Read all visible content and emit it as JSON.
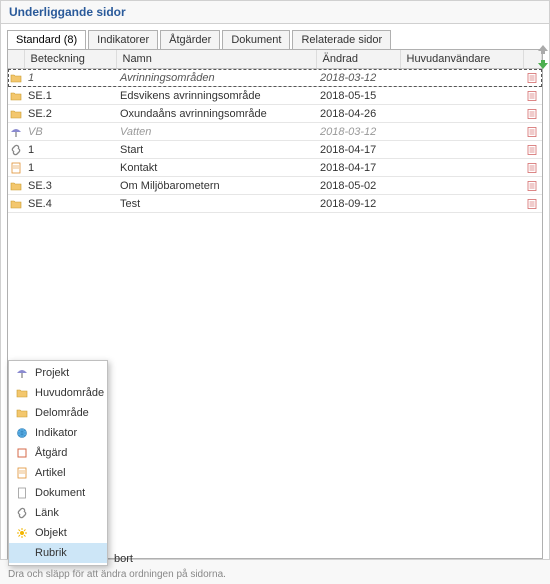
{
  "panel": {
    "title": "Underliggande sidor"
  },
  "tabs": [
    {
      "label": "Standard (8)",
      "active": true
    },
    {
      "label": "Indikatorer"
    },
    {
      "label": "Åtgärder"
    },
    {
      "label": "Dokument"
    },
    {
      "label": "Relaterade sidor"
    }
  ],
  "columns": {
    "beteckning": "Beteckning",
    "namn": "Namn",
    "andrad": "Ändrad",
    "huvudanvandare": "Huvudanvändare"
  },
  "rows": [
    {
      "icon": "folder",
      "b": "1",
      "n": "Avrinningsområden",
      "a": "2018-03-12",
      "h": "",
      "style": "italic selected"
    },
    {
      "icon": "folder",
      "b": "SE.1",
      "n": "Edsvikens avrinningsområde",
      "a": "2018-05-15",
      "h": ""
    },
    {
      "icon": "folder",
      "b": "SE.2",
      "n": "Oxundaåns avrinningsområde",
      "a": "2018-04-26",
      "h": ""
    },
    {
      "icon": "umbrella",
      "b": "VB",
      "n": "Vatten",
      "a": "2018-03-12",
      "h": "",
      "style": "dim"
    },
    {
      "icon": "link",
      "b": "1",
      "n": "Start",
      "a": "2018-04-17",
      "h": ""
    },
    {
      "icon": "doc",
      "b": "1",
      "n": "Kontakt",
      "a": "2018-04-17",
      "h": ""
    },
    {
      "icon": "folder",
      "b": "SE.3",
      "n": "Om Miljöbarometern",
      "a": "2018-05-02",
      "h": ""
    },
    {
      "icon": "folder",
      "b": "SE.4",
      "n": "Test",
      "a": "2018-09-12",
      "h": ""
    }
  ],
  "context_menu": [
    {
      "icon": "umbrella",
      "label": "Projekt"
    },
    {
      "icon": "folder",
      "label": "Huvudområde"
    },
    {
      "icon": "folder",
      "label": "Delområde"
    },
    {
      "icon": "globe",
      "label": "Indikator"
    },
    {
      "icon": "square",
      "label": "Åtgärd"
    },
    {
      "icon": "doc",
      "label": "Artikel"
    },
    {
      "icon": "page",
      "label": "Dokument"
    },
    {
      "icon": "link",
      "label": "Länk"
    },
    {
      "icon": "sun",
      "label": "Objekt"
    },
    {
      "icon": "blank",
      "label": "Rubrik",
      "selected": true
    }
  ],
  "behind_text": "bort",
  "footer": "Dra och släpp för att ändra ordningen på sidorna."
}
